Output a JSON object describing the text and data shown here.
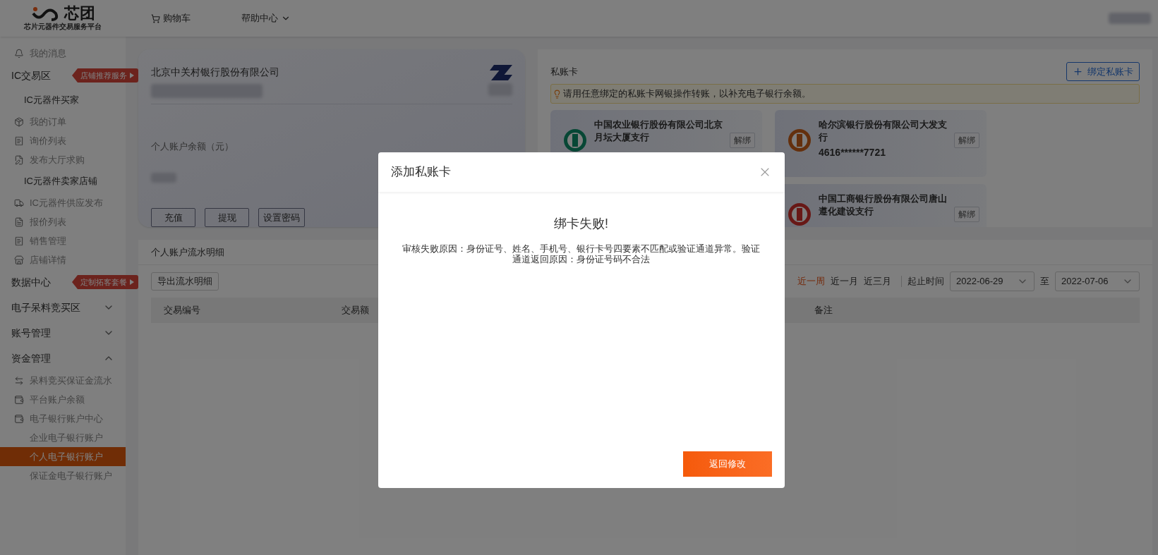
{
  "header": {
    "logo_text": "芯团",
    "logo_tagline": "芯片元器件交易服务平台",
    "nav": [
      {
        "label": "购物车",
        "kind": "cart"
      },
      {
        "label": "帮助中心",
        "kind": "dropdown"
      }
    ]
  },
  "sidebar": {
    "items": [
      {
        "kind": "link",
        "label": "我的消息",
        "selected": false
      },
      {
        "kind": "section",
        "label": "IC交易区",
        "badge": "店铺推荐服务"
      },
      {
        "kind": "group",
        "label": "IC元器件买家"
      },
      {
        "kind": "link",
        "label": "我的订单",
        "selected": false
      },
      {
        "kind": "link",
        "label": "询价列表",
        "selected": false
      },
      {
        "kind": "link",
        "label": "发布大厅求购",
        "selected": false
      },
      {
        "kind": "group",
        "label": "IC元器件卖家店铺"
      },
      {
        "kind": "link",
        "label": "IC元器件供应发布",
        "selected": false
      },
      {
        "kind": "link",
        "label": "报价列表",
        "selected": false
      },
      {
        "kind": "link",
        "label": "销售管理",
        "selected": false
      },
      {
        "kind": "link",
        "label": "店铺详情",
        "selected": false
      },
      {
        "kind": "section",
        "label": "数据中心",
        "badge": "定制拓客套餐"
      },
      {
        "kind": "section",
        "label": "电子呆料竞买区",
        "expanded": false
      },
      {
        "kind": "section",
        "label": "账号管理",
        "expanded": false
      },
      {
        "kind": "section",
        "label": "资金管理",
        "expanded": true
      },
      {
        "kind": "link",
        "label": "呆料竞买保证金流水",
        "selected": false
      },
      {
        "kind": "link",
        "label": "平台账户余额",
        "selected": false
      },
      {
        "kind": "link",
        "label": "电子银行账户中心",
        "selected": false
      },
      {
        "kind": "sub",
        "label": "企业电子银行账户",
        "selected": false
      },
      {
        "kind": "sub",
        "label": "个人电子银行账户",
        "selected": true
      },
      {
        "kind": "sub",
        "label": "保证金电子银行账户",
        "selected": false
      }
    ]
  },
  "balance_card": {
    "bank": "北京中关村银行股份有限公司",
    "balance_label": "个人账户余额（元）",
    "buttons": [
      "充值",
      "提现",
      "设置密码"
    ]
  },
  "private_cards": {
    "title": "私账卡",
    "bind_button": "绑定私账卡",
    "notice": "请用任意绑定的私账卡网银操作转账，以补充电子银行余额。",
    "columns": [
      [
        {
          "bank": "中国农业银行股份有限公司北京月坛大厦支行",
          "unbind": "解绑"
        }
      ],
      [
        {
          "bank": "哈尔滨银行股份有限公司大发支行",
          "number": "4616******7721",
          "unbind": "解绑"
        },
        {
          "bank": "中国工商银行股份有限公司唐山遵化建设支行",
          "unbind": "解绑"
        }
      ]
    ]
  },
  "ledger": {
    "title": "个人账户流水明细",
    "export_button": "导出流水明细",
    "ranges": [
      {
        "label": "近一周",
        "selected": true
      },
      {
        "label": "近一月",
        "selected": false
      },
      {
        "label": "近三月",
        "selected": false
      }
    ],
    "date_label": "起止时间",
    "date_from": "2022-06-29",
    "date_sep": "至",
    "date_to": "2022-07-06",
    "columns": [
      "交易编号",
      "交易额",
      "备注"
    ]
  },
  "dialog": {
    "title": "添加私账卡",
    "heading": "绑卡失败!",
    "message": "审核失败原因：身份证号、姓名、手机号、银行卡号四要素不匹配或验证通道异常。验证通道返回原因：身份证号码不合法",
    "button": "返回修改"
  }
}
